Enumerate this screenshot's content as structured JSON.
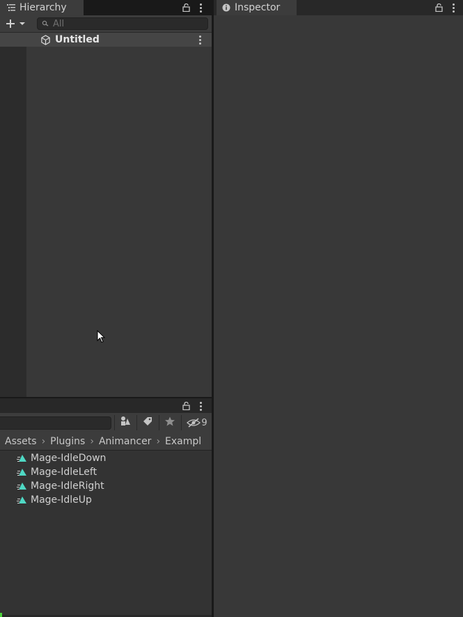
{
  "hierarchy": {
    "tab_label": "Hierarchy",
    "search_placeholder": "All",
    "scene_name": "Untitled"
  },
  "inspector": {
    "tab_label": "Inspector"
  },
  "project": {
    "hidden_count": "9",
    "breadcrumb": [
      "Assets",
      "Plugins",
      "Animancer",
      "Exampl"
    ],
    "assets": [
      {
        "label": "Mage-IdleDown"
      },
      {
        "label": "Mage-IdleLeft"
      },
      {
        "label": "Mage-IdleRight"
      },
      {
        "label": "Mage-IdleUp"
      }
    ]
  },
  "colors": {
    "accent_asset_icon": "#4fd8c4",
    "status_green": "#4cd13b"
  }
}
